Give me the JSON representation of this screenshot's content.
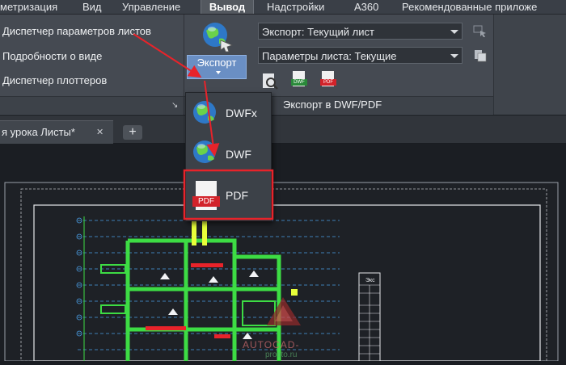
{
  "ribbon_tabs": [
    {
      "label": "метризация",
      "active": false
    },
    {
      "label": "Вид",
      "active": false
    },
    {
      "label": "Управление",
      "active": false
    },
    {
      "label": "Вывод",
      "active": true
    },
    {
      "label": "Надстройки",
      "active": false
    },
    {
      "label": "A360",
      "active": false
    },
    {
      "label": "Рекомендованные приложе",
      "active": false
    }
  ],
  "plot_panel": {
    "items": [
      "Диспетчер параметров листов",
      "Подробности о виде",
      "Диспетчер плоттеров"
    ]
  },
  "export_panel": {
    "export_button_label": "Экспорт",
    "export_combo_value": "Экспорт: Текущий лист",
    "page_setup_combo_value": "Параметры листа: Текущие",
    "panel_title": "Экспорт в DWF/PDF"
  },
  "export_dropdown": {
    "items": [
      {
        "label": "DWFx",
        "icon": "dwfx-globe-icon"
      },
      {
        "label": "DWF",
        "icon": "dwf-globe-icon"
      },
      {
        "label": "PDF",
        "icon": "pdf-file-icon",
        "icon_text": "PDF"
      }
    ]
  },
  "document_tab": {
    "title": "я урока Листы*",
    "close": "✕",
    "add": "+"
  },
  "small_icon_labels": {
    "dwf": "DWF",
    "pdf": "PDF"
  },
  "title_block": {
    "label": "Экс"
  },
  "watermark": {
    "text": "AUTOCAD-",
    "subtext": "prosto.ru"
  },
  "colors": {
    "annotation_red": "#e8232a",
    "ribbon_bg": "#454a52",
    "drawing_bg": "#1b1e23",
    "plan_green": "#3ddc44"
  }
}
